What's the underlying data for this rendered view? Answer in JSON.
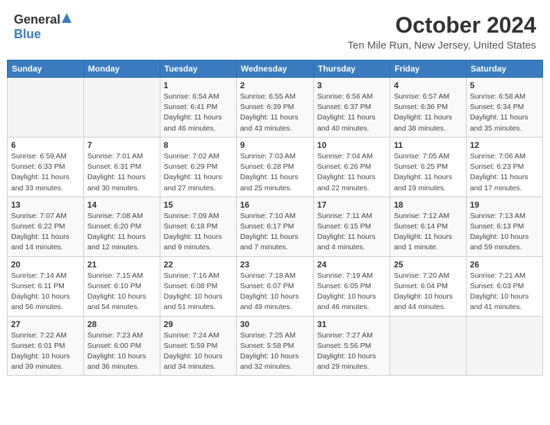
{
  "header": {
    "logo_general": "General",
    "logo_blue": "Blue",
    "month_title": "October 2024",
    "location": "Ten Mile Run, New Jersey, United States"
  },
  "days_of_week": [
    "Sunday",
    "Monday",
    "Tuesday",
    "Wednesday",
    "Thursday",
    "Friday",
    "Saturday"
  ],
  "weeks": [
    [
      {
        "day": "",
        "info": ""
      },
      {
        "day": "",
        "info": ""
      },
      {
        "day": "1",
        "info": "Sunrise: 6:54 AM\nSunset: 6:41 PM\nDaylight: 11 hours and 46 minutes."
      },
      {
        "day": "2",
        "info": "Sunrise: 6:55 AM\nSunset: 6:39 PM\nDaylight: 11 hours and 43 minutes."
      },
      {
        "day": "3",
        "info": "Sunrise: 6:56 AM\nSunset: 6:37 PM\nDaylight: 11 hours and 40 minutes."
      },
      {
        "day": "4",
        "info": "Sunrise: 6:57 AM\nSunset: 6:36 PM\nDaylight: 11 hours and 38 minutes."
      },
      {
        "day": "5",
        "info": "Sunrise: 6:58 AM\nSunset: 6:34 PM\nDaylight: 11 hours and 35 minutes."
      }
    ],
    [
      {
        "day": "6",
        "info": "Sunrise: 6:59 AM\nSunset: 6:33 PM\nDaylight: 11 hours and 33 minutes."
      },
      {
        "day": "7",
        "info": "Sunrise: 7:01 AM\nSunset: 6:31 PM\nDaylight: 11 hours and 30 minutes."
      },
      {
        "day": "8",
        "info": "Sunrise: 7:02 AM\nSunset: 6:29 PM\nDaylight: 11 hours and 27 minutes."
      },
      {
        "day": "9",
        "info": "Sunrise: 7:03 AM\nSunset: 6:28 PM\nDaylight: 11 hours and 25 minutes."
      },
      {
        "day": "10",
        "info": "Sunrise: 7:04 AM\nSunset: 6:26 PM\nDaylight: 11 hours and 22 minutes."
      },
      {
        "day": "11",
        "info": "Sunrise: 7:05 AM\nSunset: 6:25 PM\nDaylight: 11 hours and 19 minutes."
      },
      {
        "day": "12",
        "info": "Sunrise: 7:06 AM\nSunset: 6:23 PM\nDaylight: 11 hours and 17 minutes."
      }
    ],
    [
      {
        "day": "13",
        "info": "Sunrise: 7:07 AM\nSunset: 6:22 PM\nDaylight: 11 hours and 14 minutes."
      },
      {
        "day": "14",
        "info": "Sunrise: 7:08 AM\nSunset: 6:20 PM\nDaylight: 11 hours and 12 minutes."
      },
      {
        "day": "15",
        "info": "Sunrise: 7:09 AM\nSunset: 6:18 PM\nDaylight: 11 hours and 9 minutes."
      },
      {
        "day": "16",
        "info": "Sunrise: 7:10 AM\nSunset: 6:17 PM\nDaylight: 11 hours and 7 minutes."
      },
      {
        "day": "17",
        "info": "Sunrise: 7:11 AM\nSunset: 6:15 PM\nDaylight: 11 hours and 4 minutes."
      },
      {
        "day": "18",
        "info": "Sunrise: 7:12 AM\nSunset: 6:14 PM\nDaylight: 11 hours and 1 minute."
      },
      {
        "day": "19",
        "info": "Sunrise: 7:13 AM\nSunset: 6:13 PM\nDaylight: 10 hours and 59 minutes."
      }
    ],
    [
      {
        "day": "20",
        "info": "Sunrise: 7:14 AM\nSunset: 6:11 PM\nDaylight: 10 hours and 56 minutes."
      },
      {
        "day": "21",
        "info": "Sunrise: 7:15 AM\nSunset: 6:10 PM\nDaylight: 10 hours and 54 minutes."
      },
      {
        "day": "22",
        "info": "Sunrise: 7:16 AM\nSunset: 6:08 PM\nDaylight: 10 hours and 51 minutes."
      },
      {
        "day": "23",
        "info": "Sunrise: 7:18 AM\nSunset: 6:07 PM\nDaylight: 10 hours and 49 minutes."
      },
      {
        "day": "24",
        "info": "Sunrise: 7:19 AM\nSunset: 6:05 PM\nDaylight: 10 hours and 46 minutes."
      },
      {
        "day": "25",
        "info": "Sunrise: 7:20 AM\nSunset: 6:04 PM\nDaylight: 10 hours and 44 minutes."
      },
      {
        "day": "26",
        "info": "Sunrise: 7:21 AM\nSunset: 6:03 PM\nDaylight: 10 hours and 41 minutes."
      }
    ],
    [
      {
        "day": "27",
        "info": "Sunrise: 7:22 AM\nSunset: 6:01 PM\nDaylight: 10 hours and 39 minutes."
      },
      {
        "day": "28",
        "info": "Sunrise: 7:23 AM\nSunset: 6:00 PM\nDaylight: 10 hours and 36 minutes."
      },
      {
        "day": "29",
        "info": "Sunrise: 7:24 AM\nSunset: 5:59 PM\nDaylight: 10 hours and 34 minutes."
      },
      {
        "day": "30",
        "info": "Sunrise: 7:25 AM\nSunset: 5:58 PM\nDaylight: 10 hours and 32 minutes."
      },
      {
        "day": "31",
        "info": "Sunrise: 7:27 AM\nSunset: 5:56 PM\nDaylight: 10 hours and 29 minutes."
      },
      {
        "day": "",
        "info": ""
      },
      {
        "day": "",
        "info": ""
      }
    ]
  ]
}
